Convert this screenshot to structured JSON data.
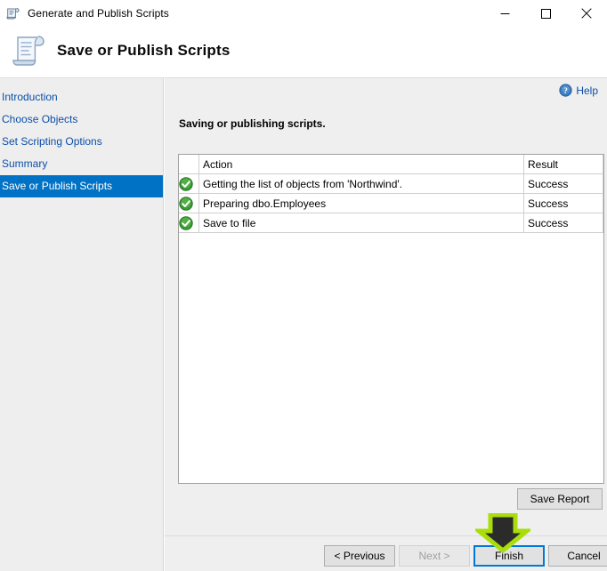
{
  "window": {
    "title": "Generate and Publish Scripts",
    "icon": "script-document-icon",
    "controls": {
      "minimize": "minimize-icon",
      "maximize": "maximize-icon",
      "close": "close-icon"
    }
  },
  "banner": {
    "heading": "Save or Publish Scripts",
    "icon": "script-scroll-icon"
  },
  "sidebar": {
    "items": [
      {
        "label": "Introduction",
        "selected": false
      },
      {
        "label": "Choose Objects",
        "selected": false
      },
      {
        "label": "Set Scripting Options",
        "selected": false
      },
      {
        "label": "Summary",
        "selected": false
      },
      {
        "label": "Save or Publish Scripts",
        "selected": true
      }
    ]
  },
  "main": {
    "help_label": "Help",
    "help_icon": "help-circle-icon",
    "section_title": "Saving or publishing scripts.",
    "table": {
      "columns": [
        "",
        "Action",
        "Result"
      ],
      "rows": [
        {
          "status_icon": "success-check-icon",
          "action": "Getting the list of objects from 'Northwind'.",
          "result": "Success"
        },
        {
          "status_icon": "success-check-icon",
          "action": "Preparing dbo.Employees",
          "result": "Success"
        },
        {
          "status_icon": "success-check-icon",
          "action": "Save to file",
          "result": "Success"
        }
      ]
    },
    "save_report_label": "Save Report"
  },
  "footer": {
    "previous_label": "< Previous",
    "next_label": "Next >",
    "next_disabled": true,
    "finish_label": "Finish",
    "cancel_label": "Cancel"
  },
  "annotation": {
    "arrow": "down-arrow-annotation",
    "outline_color": "#aade0b",
    "fill_color": "#2b2b2b",
    "points_to": "Finish"
  },
  "colors": {
    "selection_blue": "#0072c6",
    "link_blue": "#0b4fa8",
    "focus_blue": "#0078d7",
    "success_green": "#3a9b35",
    "panel_gray": "#efefef",
    "sidebar_gray": "#eeeeee"
  }
}
